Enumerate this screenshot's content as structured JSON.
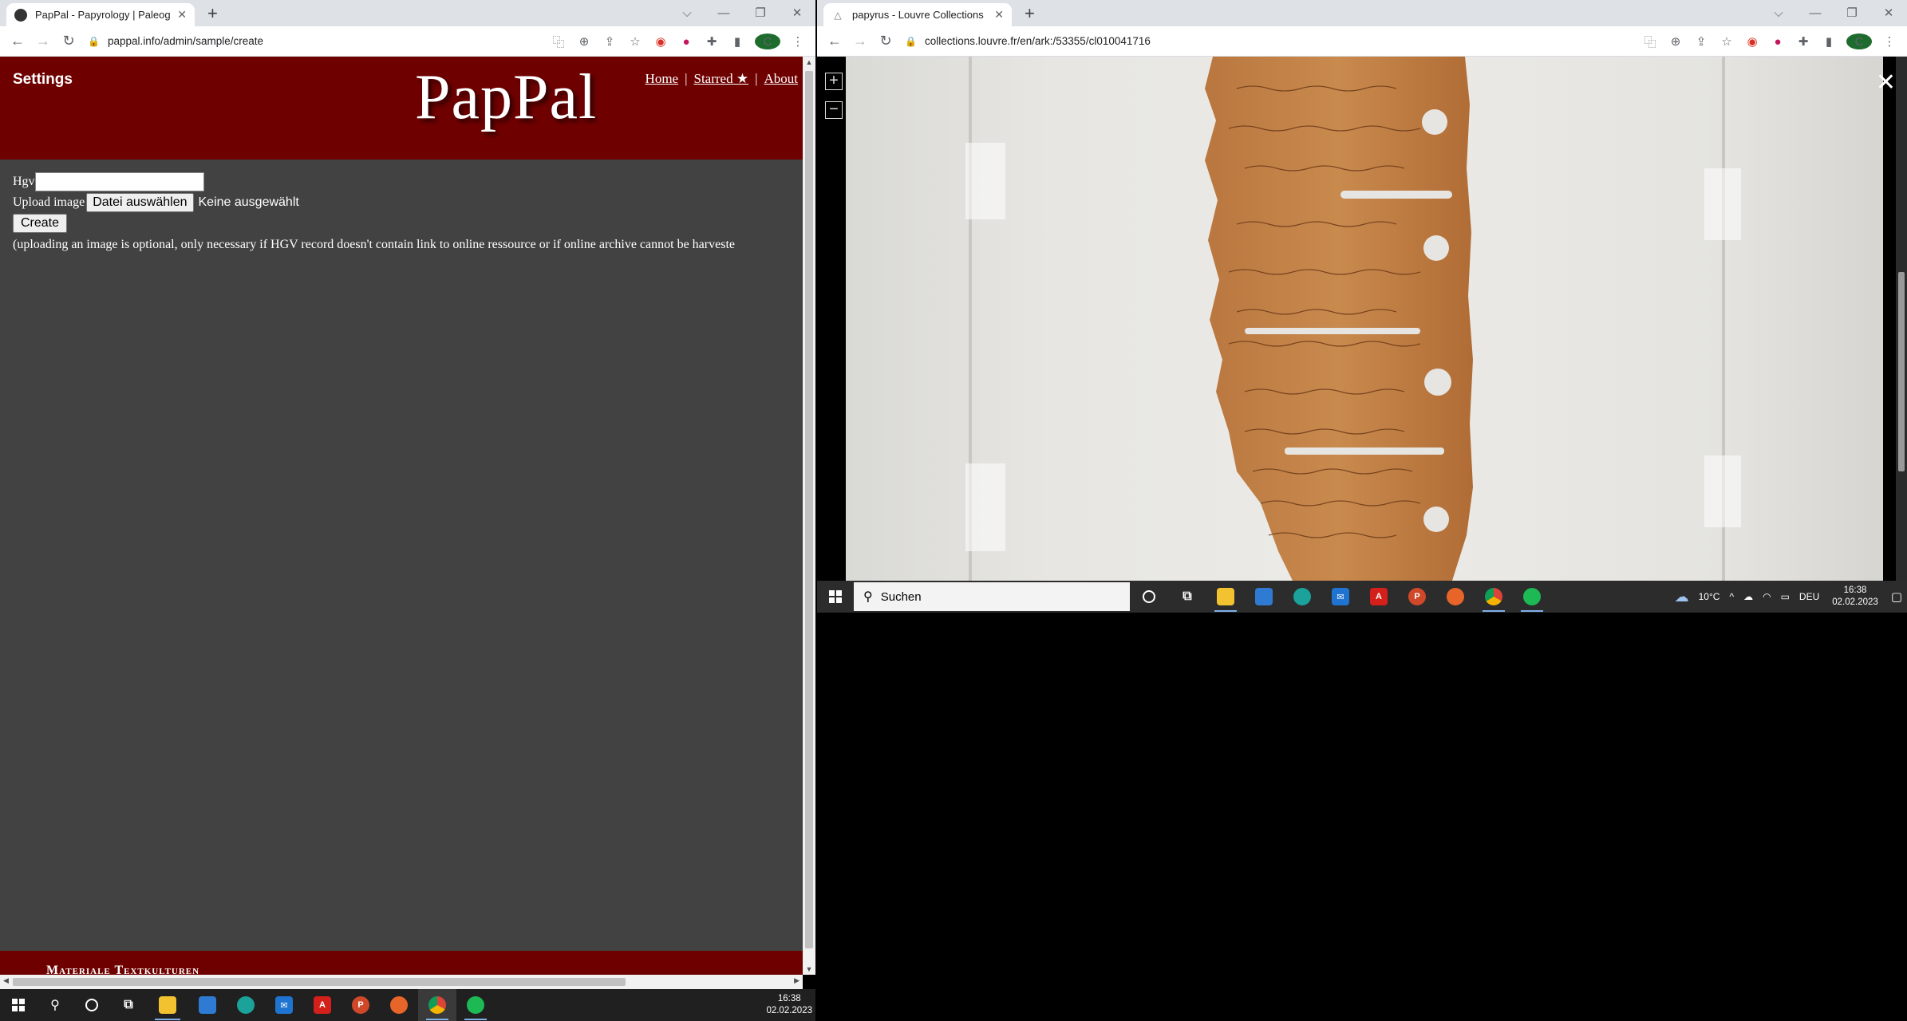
{
  "left_browser": {
    "tab_title": "PapPal - Papyrology | Paleograph",
    "url": "pappal.info/admin/sample/create",
    "profile_initial": "C"
  },
  "pappal": {
    "settings_label": "Settings",
    "logo": "PapPal",
    "nav": {
      "home": "Home",
      "starred": "Starred ★",
      "about": "About",
      "sep": "|"
    },
    "form": {
      "hgv_label": "Hgv",
      "hgv_value": "",
      "upload_label": "Upload image",
      "file_button": "Datei auswählen",
      "file_status": "Keine ausgewählt",
      "create_button": "Create",
      "hint": "(uploading an image is optional, only necessary if HGV record doesn't contain link to online ressource or if online archive cannot be harveste"
    },
    "footer_text": "Materiale Textkulturen"
  },
  "right_browser": {
    "tab_title": "papyrus - Louvre Collections",
    "url": "collections.louvre.fr/en/ark:/53355/cl010041716",
    "profile_initial": "C"
  },
  "viewer": {
    "zoom_in": "+",
    "zoom_out": "−",
    "close": "✕"
  },
  "taskbar_right": {
    "search_placeholder": "Suchen",
    "weather": "10°C",
    "language": "DEU",
    "time": "16:38",
    "date": "02.02.2023"
  },
  "taskbar_bottom": {
    "time": "16:38",
    "date": "02.02.2023"
  },
  "colors": {
    "pappal_red": "#6f0000",
    "pappal_body": "#424242",
    "chrome_bg": "#dee1e6"
  }
}
